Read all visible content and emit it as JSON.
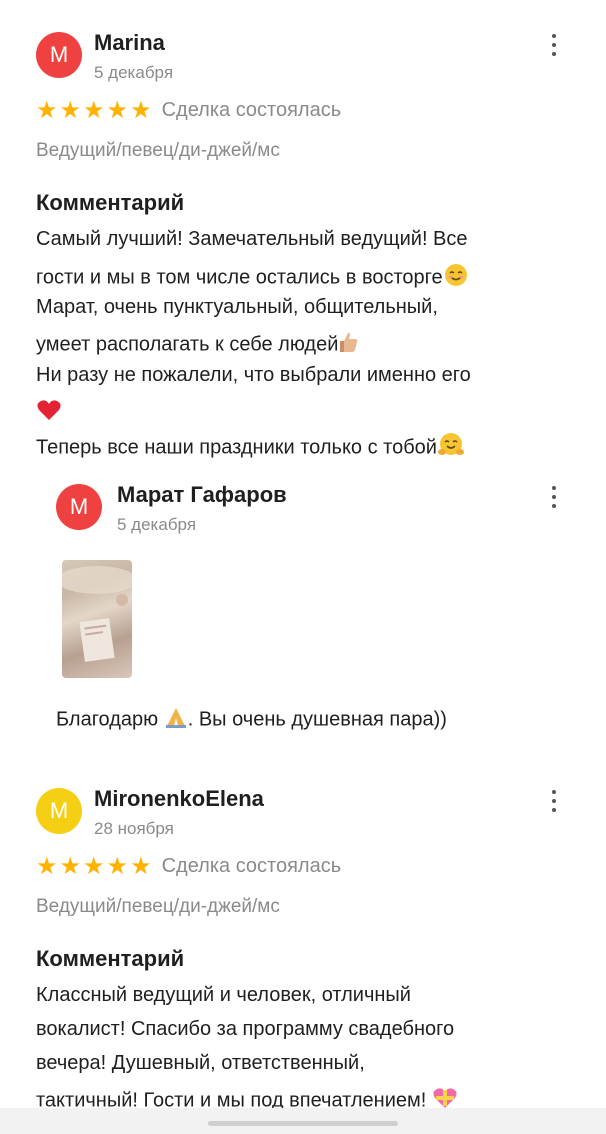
{
  "reviews": [
    {
      "avatar_letter": "M",
      "avatar_color": "#ef4140",
      "author": "Marina",
      "date": "5 декабря",
      "stars": 5,
      "deal_status": "Сделка состоялась",
      "category": "Ведущий/певец/ди-джей/мс",
      "comment_title": "Комментарий",
      "comment_lines": [
        "Самый лучший! Замечательный ведущий! Все",
        "гости и мы в том числе остались в восторге",
        "Марат, очень пунктуальный, общительный,",
        "умеет располагать к себе людей",
        "Ни разу не пожалели, что выбрали именно его",
        "",
        "Теперь все наши праздники только с тобой"
      ],
      "reply": {
        "avatar_letter": "M",
        "author": "Марат Гафаров",
        "date": "5 декабря",
        "text": "Благодарю . Вы очень душевная пара))"
      }
    },
    {
      "avatar_letter": "M",
      "avatar_color": "#f5cf14",
      "author": "MironenkoElena",
      "date": "28 ноября",
      "stars": 5,
      "deal_status": "Сделка состоялась",
      "category": "Ведущий/певец/ди-джей/мс",
      "comment_title": "Комментарий",
      "comment_lines": [
        "Классный ведущий и человек, отличный",
        "вокалист! Спасибо за программу свадебного",
        "вечера! Душевный, ответственный,",
        "тактичный! Гости и мы под впечатлением!"
      ]
    }
  ],
  "icons": {
    "star": "star-icon",
    "more": "more-vertical-icon",
    "emoji_smile": "smiling-face-icon",
    "emoji_thumbs": "thumbs-up-icon",
    "emoji_heart": "red-heart-icon",
    "emoji_hug": "hugging-face-icon",
    "emoji_pray": "folded-hands-icon",
    "emoji_heart_ribbon": "heart-with-ribbon-icon"
  },
  "colors": {
    "star": "#ffb300",
    "secondary_text": "#8a8a8a"
  }
}
